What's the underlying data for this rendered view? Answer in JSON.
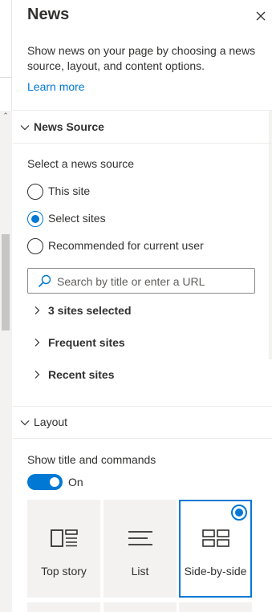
{
  "panel": {
    "title": "News",
    "description": "Show news on your page by choosing a news source, layout, and content options.",
    "learn_more": "Learn more"
  },
  "news_source": {
    "heading": "News Source",
    "select_label": "Select a news source",
    "options": [
      "This site",
      "Select sites",
      "Recommended for current user"
    ],
    "selected_option": "Select sites",
    "search_placeholder": "Search by title or enter a URL",
    "expanders": [
      "3 sites selected",
      "Frequent sites",
      "Recent sites"
    ]
  },
  "layout": {
    "heading": "Layout",
    "show_title_label": "Show title and commands",
    "toggle_state": "On",
    "tiles": [
      "Top story",
      "List",
      "Side-by-side"
    ],
    "selected_tile": "Side-by-side"
  },
  "colors": {
    "accent": "#0078d4",
    "text": "#323130",
    "tile_bg": "#f3f2f1"
  }
}
